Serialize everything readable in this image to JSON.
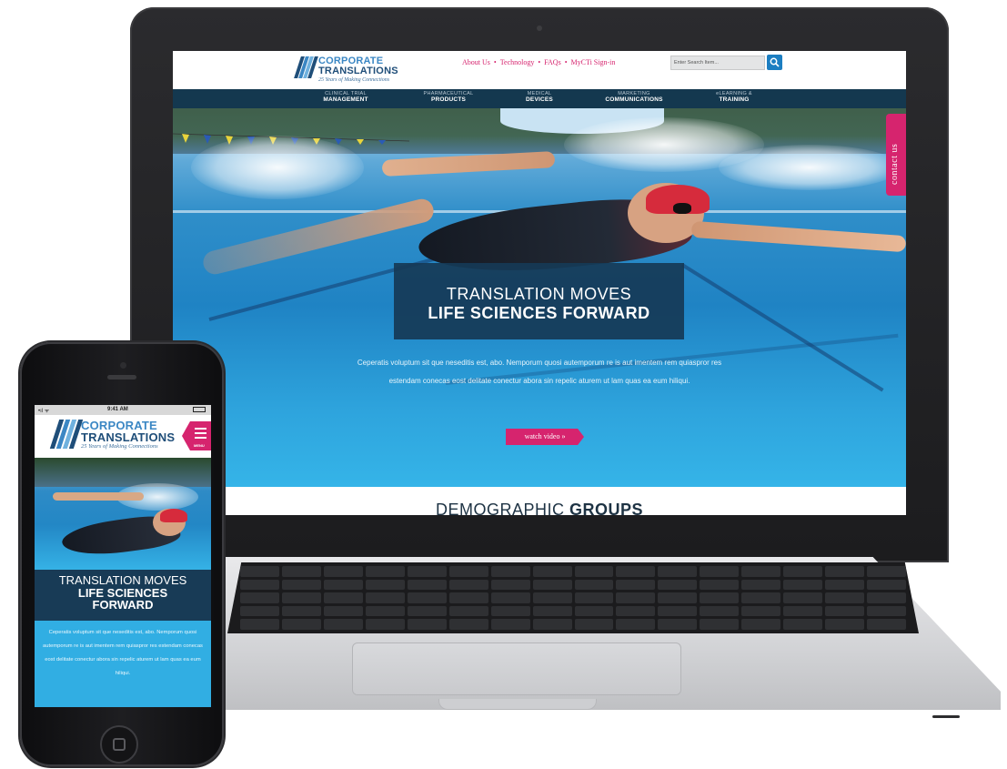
{
  "laptop_site": {
    "logo": {
      "line1": "CORPORATE",
      "line2": "TRANSLATIONS",
      "tagline": "25 Years of Making Connections"
    },
    "top_nav": [
      {
        "label": "About Us"
      },
      {
        "label": "Technology"
      },
      {
        "label": "FAQs"
      },
      {
        "label": "MyCTi Sign-in"
      }
    ],
    "top_nav_separator": "•",
    "search": {
      "placeholder": "Enter Search Item..."
    },
    "main_nav": [
      {
        "small": "CLINICAL TRIAL",
        "big": "MANAGEMENT"
      },
      {
        "small": "PHARMACEUTICAL",
        "big": "PRODUCTS"
      },
      {
        "small": "MEDICAL",
        "big": "DEVICES"
      },
      {
        "small": "MARKETING",
        "big": "COMMUNICATIONS"
      },
      {
        "small": "eLEARNING &",
        "big": "TRAINING"
      }
    ],
    "hero": {
      "title_line1": "TRANSLATION MOVES",
      "title_line2": "LIFE SCIENCES FORWARD",
      "copy": "Ceperatis voluptum sit que neseditis est, abo. Nemporum quosi autemporum re is aut imentem rem quiaspror res estendam conecas eost delitate conectur abora sin repelic aturem ut lam quas ea eum hiliqui.",
      "cta": "watch video »"
    },
    "contact_tab": "contact us",
    "section_heading": {
      "light": "DEMOGRAPHIC",
      "bold": "GROUPS"
    }
  },
  "phone_site": {
    "status_bar": {
      "carrier": "•ıl ᯤ",
      "time": "9:41 AM"
    },
    "logo": {
      "line1": "CORPORATE",
      "line2": "TRANSLATIONS",
      "tagline": "25 Years of Making Connections"
    },
    "menu_label": "MENU",
    "hero": {
      "title_line1": "TRANSLATION MOVES",
      "title_line2": "LIFE SCIENCES",
      "title_line3": "FORWARD",
      "copy": "Ceperatis voluptum sit que neseditis est, abo. Nemporum quosi autemporum re is aut imentem rem quiaspror res estendam conecas eost delitate conectur abora sin repelic aturem ut lam quas ea eum hiliqui."
    }
  },
  "colors": {
    "brand_navy": "#14384f",
    "brand_pink": "#d6246e",
    "brand_blue": "#1c7ec1",
    "hero_blue": "#31aee3"
  }
}
